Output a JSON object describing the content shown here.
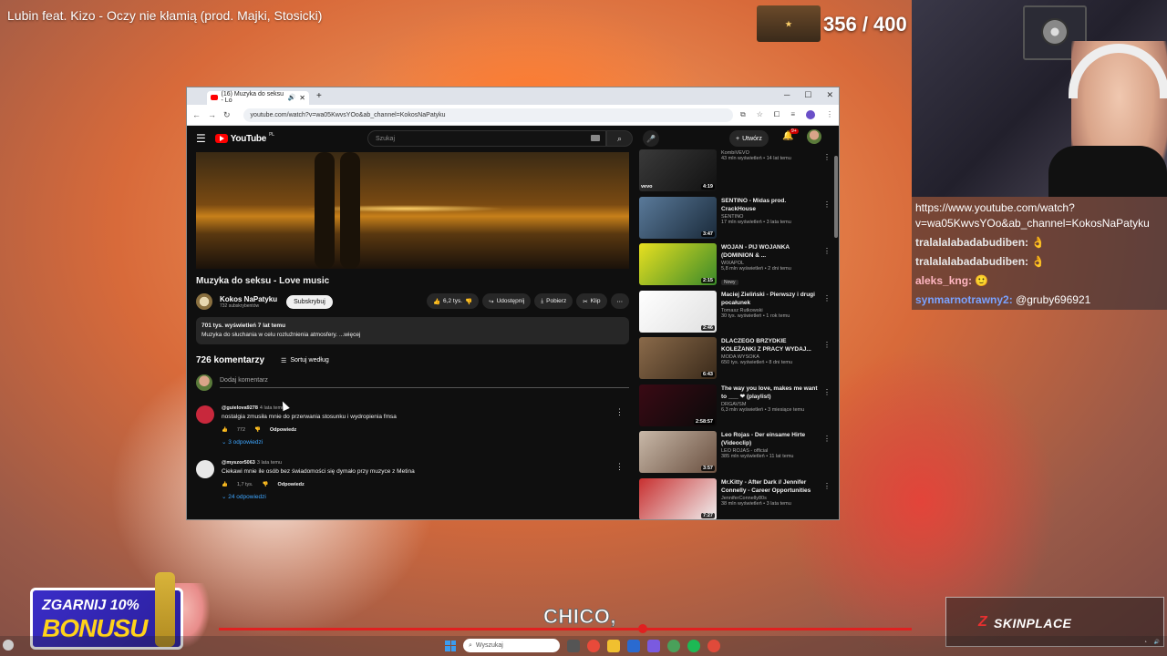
{
  "overlay": {
    "song_title": "Lubin feat. Kizo - Oczy nie kłamią (prod. Majki, Stosicki)",
    "counter": "356 / 400",
    "lyric": "CHICO,",
    "promo_line1": "ZGARNIJ 10%",
    "promo_line2": "BONUSU",
    "skinplace": "SKINPLACE"
  },
  "chat": [
    {
      "user": "",
      "text": "https://www.youtube.com/watch?v=wa05KwvsYOo&ab_channel=KokosNaPatyku",
      "user_color": "#ffffff"
    },
    {
      "user": "tralalalabadabudiben:",
      "text": "👌",
      "user_color": "#e8e8e8"
    },
    {
      "user": "tralalalabadabudiben:",
      "text": "👌",
      "user_color": "#e8e8e8"
    },
    {
      "user": "aleks_kng:",
      "text": "",
      "user_color": "#ffb6c1"
    },
    {
      "user": "synmarnotrawny2:",
      "text": "@gruby696921",
      "user_color": "#7aa2ff"
    }
  ],
  "browser": {
    "tab_title": "(16) Muzyka do seksu - Lo",
    "url": "youtube.com/watch?v=wa05KwvsYOo&ab_channel=KokosNaPatyku"
  },
  "yt": {
    "logo": "YouTube",
    "region": "PL",
    "search_placeholder": "Szukaj",
    "create_label": "Utwórz",
    "bell_count": "9+",
    "video_title": "Muzyka do seksu - Love music",
    "channel_name": "Kokos NaPatyku",
    "channel_subs": "732 subskrybentów",
    "subscribe_label": "Subskrybuj",
    "like_count": "6,2 tys.",
    "share_label": "Udostępnij",
    "download_label": "Pobierz",
    "clip_label": "Klip",
    "desc_stats": "701 tys. wyświetleń  7 lat temu",
    "desc_text": "Muzyka do słuchania w celu rozluźnienia atmosfery. ...więcej",
    "comments_count": "726 komentarzy",
    "sort_label": "Sortuj według",
    "add_comment": "Dodaj komentarz",
    "comments": [
      {
        "author": "@guielova9278",
        "time": "4 lata temu",
        "text": "nostalgia zmusiła mnie do przerwania stosunku i wydropienia fmsa",
        "likes": "772",
        "reply": "Odpowiedz",
        "replies": "3 odpowiedzi",
        "avatar_color": "#c8283c"
      },
      {
        "author": "@myszor5063",
        "time": "3 lata temu",
        "text": "Ciekawi mnie ile osób bez świadomości się dymało przy muzyce z Metina",
        "likes": "1,7 tys.",
        "reply": "Odpowiedz",
        "replies": "24 odpowiedzi",
        "avatar_color": "#e8e8e8"
      }
    ],
    "recommendations": [
      {
        "title": "",
        "channel": "KombiVEVO",
        "meta": "43 mln wyświetleń • 14 lat temu",
        "duration": "4:19",
        "vevo": true,
        "badge": "",
        "thumb": "linear-gradient(135deg,#3a3a3a,#111)"
      },
      {
        "title": "SENTINO - Midas prod. CrackHouse",
        "channel": "SENTINO",
        "meta": "17 mln wyświetleń • 3 lata temu",
        "duration": "3:47",
        "vevo": false,
        "badge": "",
        "thumb": "linear-gradient(135deg,#5a7a9a,#1a2a3a)"
      },
      {
        "title": "WOJAN - PIJ WOJANKA (DOMINION & ...",
        "channel": "WIXAPOL",
        "meta": "5,8 mln wyświetleń • 2 dni temu",
        "duration": "2:15",
        "vevo": false,
        "badge": "Nowy",
        "thumb": "linear-gradient(135deg,#e8e020,#3a8a2a)"
      },
      {
        "title": "Maciej Zieliński - Pierwszy i drugi pocałunek",
        "channel": "Tomasz Rutkowski",
        "meta": "30 tys. wyświetleń • 1 rok temu",
        "duration": "2:46",
        "vevo": false,
        "badge": "",
        "thumb": "linear-gradient(135deg,#ffffff,#e0e0e0)"
      },
      {
        "title": "DLACZEGO BRZYDKIE KOLEŻANKI Z PRACY WYDAJ...",
        "channel": "MODA WYSOKA",
        "meta": "650 tys. wyświetleń • 8 dni temu",
        "duration": "6:43",
        "vevo": false,
        "badge": "",
        "thumb": "linear-gradient(135deg,#8a6a4a,#3a2a1a)"
      },
      {
        "title": "The way you love, makes me want to ___ ❤ (playlist)",
        "channel": "DRGAVSM",
        "meta": "6,3 mln wyświetleń • 3 miesiące temu",
        "duration": "2:58:57",
        "vevo": false,
        "badge": "",
        "thumb": "linear-gradient(135deg,#3a0a14,#0a0a0a)"
      },
      {
        "title": "Leo Rojas - Der einsame Hirte (Videoclip)",
        "channel": "LEO ROJAS - official",
        "meta": "385 mln wyświetleń • 11 lat temu",
        "duration": "3:57",
        "vevo": false,
        "badge": "",
        "thumb": "linear-gradient(135deg,#c8b8a8,#6a5040)"
      },
      {
        "title": "Mr.Kitty - After Dark // Jennifer Connelly - Career Opportunities",
        "channel": "JenniferConnelly80s",
        "meta": "38 mln wyświetleń • 3 lata temu",
        "duration": "7:27",
        "vevo": false,
        "badge": "",
        "thumb": "linear-gradient(135deg,#c83030,#f0f0f0)"
      }
    ]
  },
  "taskbar": {
    "search_placeholder": "Wyszukaj"
  }
}
